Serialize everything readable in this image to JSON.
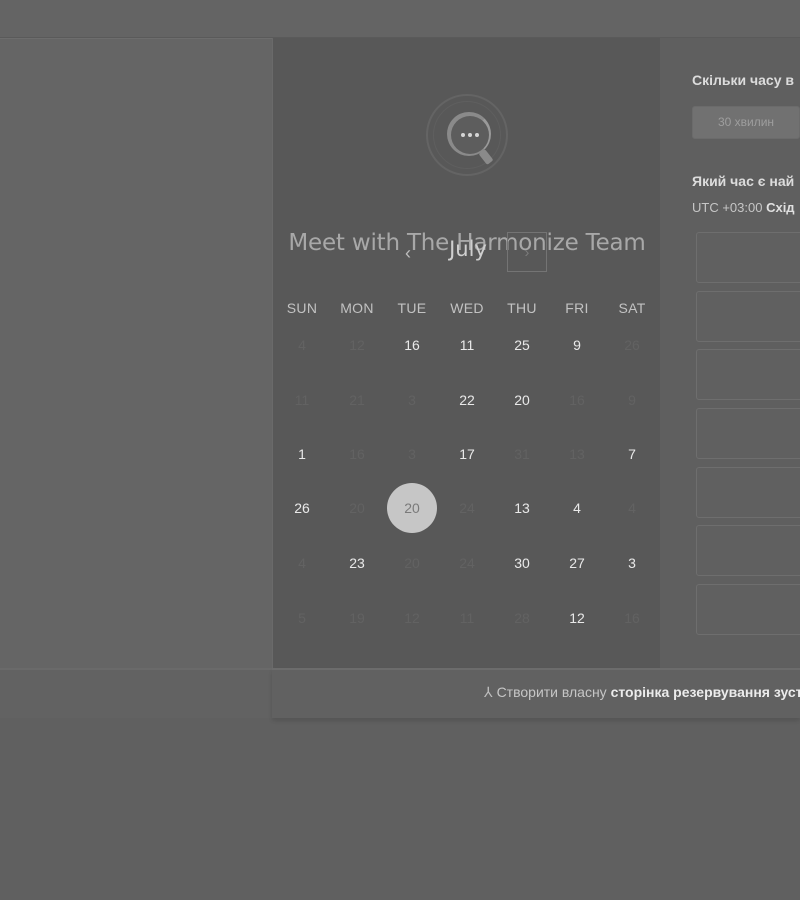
{
  "calendar": {
    "title": "Meet with The Harmonize Team",
    "month": "July",
    "prev_glyph": "‹",
    "next_glyph": "›",
    "weekdays": [
      "SUN",
      "MON",
      "TUE",
      "WED",
      "THU",
      "FRI",
      "SAT"
    ],
    "weeks": [
      [
        {
          "d": "4",
          "dim": true
        },
        {
          "d": "12",
          "dim": true
        },
        {
          "d": "16",
          "dim": false
        },
        {
          "d": "11",
          "dim": false
        },
        {
          "d": "25",
          "dim": false
        },
        {
          "d": "9",
          "dim": false
        },
        {
          "d": "26",
          "dim": true
        }
      ],
      [
        {
          "d": "11",
          "dim": true
        },
        {
          "d": "21",
          "dim": true
        },
        {
          "d": "3",
          "dim": true
        },
        {
          "d": "22",
          "dim": false
        },
        {
          "d": "20",
          "dim": false
        },
        {
          "d": "16",
          "dim": true
        },
        {
          "d": "9",
          "dim": true
        }
      ],
      [
        {
          "d": "1",
          "dim": false
        },
        {
          "d": "16",
          "dim": true
        },
        {
          "d": "3",
          "dim": true
        },
        {
          "d": "17",
          "dim": false
        },
        {
          "d": "31",
          "dim": true
        },
        {
          "d": "13",
          "dim": true
        },
        {
          "d": "7",
          "dim": false
        }
      ],
      [
        {
          "d": "26",
          "dim": false
        },
        {
          "d": "20",
          "dim": true
        },
        {
          "d": "20",
          "dim": false,
          "selected": true
        },
        {
          "d": "24",
          "dim": true
        },
        {
          "d": "13",
          "dim": false
        },
        {
          "d": "4",
          "dim": false
        },
        {
          "d": "4",
          "dim": true
        }
      ],
      [
        {
          "d": "4",
          "dim": true
        },
        {
          "d": "23",
          "dim": false
        },
        {
          "d": "20",
          "dim": true
        },
        {
          "d": "24",
          "dim": true
        },
        {
          "d": "30",
          "dim": false
        },
        {
          "d": "27",
          "dim": false
        },
        {
          "d": "3",
          "dim": false
        }
      ],
      [
        {
          "d": "5",
          "dim": true
        },
        {
          "d": "19",
          "dim": true
        },
        {
          "d": "12",
          "dim": true
        },
        {
          "d": "11",
          "dim": true
        },
        {
          "d": "28",
          "dim": true
        },
        {
          "d": "12",
          "dim": false
        },
        {
          "d": "16",
          "dim": true
        }
      ]
    ]
  },
  "booking": {
    "duration_heading": "Скільки часу в",
    "duration_option": "30 хвилин",
    "time_heading": "Який час є най",
    "timezone_prefix": "UTC +03:00",
    "timezone_name": "Схід",
    "slot_count": 7
  },
  "footer": {
    "prefix": "Створити власну",
    "link": "сторінка резервування зуст"
  }
}
